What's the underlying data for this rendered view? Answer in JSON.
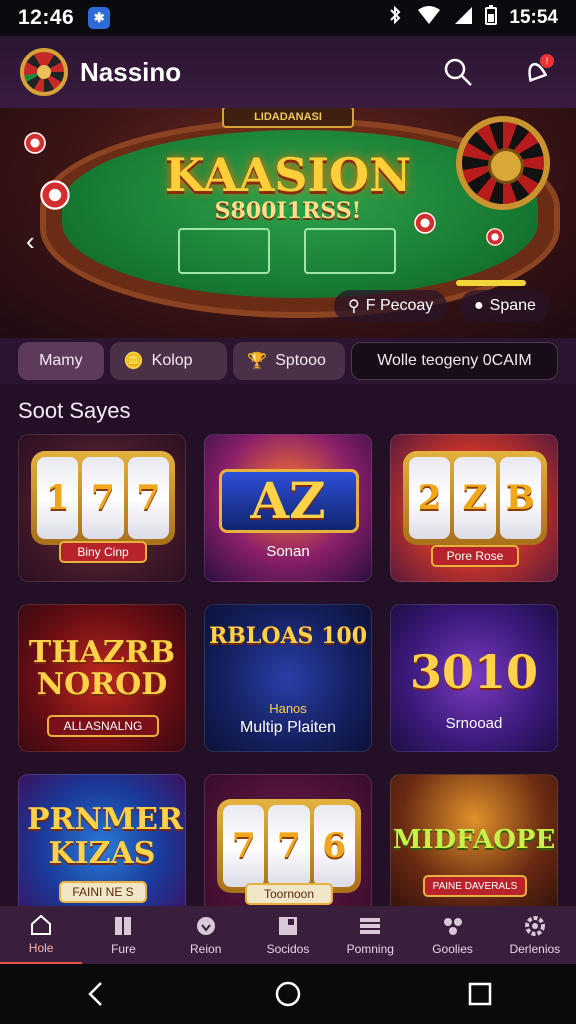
{
  "status_bar": {
    "time": "12:46",
    "clock_right": "15:54"
  },
  "app": {
    "name": "Nassino"
  },
  "hero": {
    "banner": "LIDADANASI",
    "title": "KAASION",
    "subtitle": "S800I1RSS!",
    "pill_left": "F Pecoay",
    "pill_right": "Spane"
  },
  "filters": [
    {
      "label": "Mamy"
    },
    {
      "label": "Kolop"
    },
    {
      "label": "Sptooo"
    },
    {
      "label": "Wolle teogeny 0CAIM"
    }
  ],
  "section": {
    "title": "Soot Sayes"
  },
  "games": [
    {
      "reels": [
        "1",
        "7",
        "7"
      ],
      "caption": "Biny Cinp"
    },
    {
      "big": "AZ",
      "caption": "Sonan"
    },
    {
      "reels": [
        "2",
        "Z",
        "B"
      ],
      "caption": "Pore Rose"
    },
    {
      "big": "THAZRB NOROD",
      "caption": "ALLASNALNG"
    },
    {
      "big": "RBLOAS 100",
      "sub": "Hanos",
      "caption": "Multip Plaiten"
    },
    {
      "big": "3010",
      "caption": "Srnooad"
    },
    {
      "big": "PRNMERS KIZAS",
      "caption": "FAINI NE S"
    },
    {
      "reels": [
        "7",
        "7",
        "6"
      ],
      "caption": "Toornoon"
    },
    {
      "big": "MIDFAOPE",
      "caption": "PAINE DAVERALS"
    }
  ],
  "bottom_nav": [
    {
      "label": "Hole",
      "icon": "home-icon"
    },
    {
      "label": "Fure",
      "icon": "book-icon"
    },
    {
      "label": "Reion",
      "icon": "shield-icon"
    },
    {
      "label": "Socidos",
      "icon": "grid-icon"
    },
    {
      "label": "Pomning",
      "icon": "list-icon"
    },
    {
      "label": "Goolies",
      "icon": "group-icon"
    },
    {
      "label": "Derlenios",
      "icon": "settings-icon"
    }
  ],
  "colors": {
    "accent": "#e2534a",
    "gold": "#ffd24a",
    "felt": "#15762f"
  }
}
